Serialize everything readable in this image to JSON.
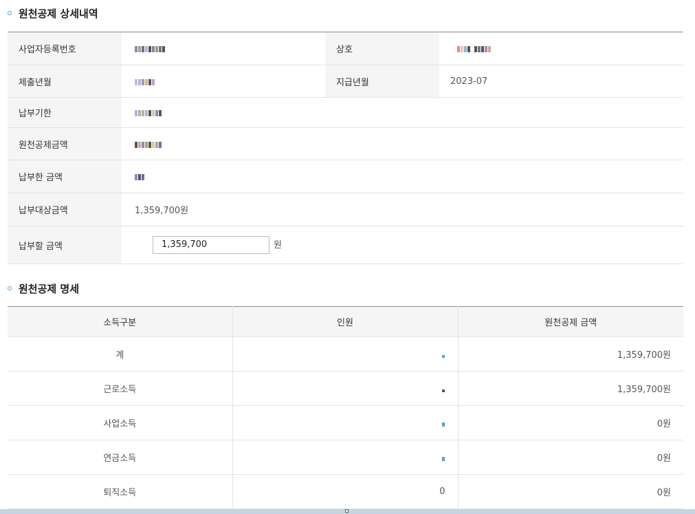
{
  "section1": {
    "title": "원천공제 상세내역",
    "rows": [
      {
        "label": "사업자등록번호",
        "label2": "상호"
      },
      {
        "label": "제출년월",
        "label2": "지급년월",
        "value2": "2023-07"
      },
      {
        "label": "납부기한"
      },
      {
        "label": "원천공제금액"
      },
      {
        "label": "납부한 금액"
      },
      {
        "label": "납부대상금액",
        "value": "1,359,700원"
      },
      {
        "label": "납부할 금액",
        "input_value": "1,359,700",
        "unit": "원"
      }
    ]
  },
  "section2": {
    "title": "원천공제 명세",
    "headers": [
      "소득구분",
      "인원",
      "원천공제 금액"
    ],
    "rows": [
      {
        "category": "계",
        "amount": "1,359,700원"
      },
      {
        "category": "근로소득",
        "amount": "1,359,700원"
      },
      {
        "category": "사업소득",
        "amount": "0원"
      },
      {
        "category": "연금소득",
        "amount": "0원"
      },
      {
        "category": "퇴직소득",
        "count": "0",
        "amount": "0원"
      }
    ]
  },
  "colors": {
    "bullet": "#4aa3df",
    "label_bg": "#f5f5f5",
    "border": "#e3e3e3"
  }
}
